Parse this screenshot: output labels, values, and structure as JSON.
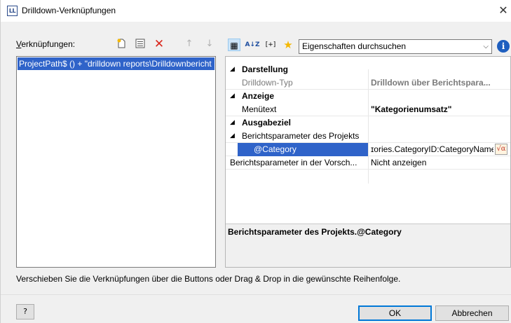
{
  "window": {
    "title": "Drilldown-Verknüpfungen",
    "app_icon_text": "LL",
    "close_glyph": "✕"
  },
  "left": {
    "label_prefix": "V",
    "label_rest": "erknüpfungen:",
    "toolbar": {
      "new_icon": "new-document-icon",
      "properties_icon": "list-properties-icon",
      "delete_icon": "delete-x-icon",
      "delete_glyph": "✕",
      "up_glyph": "↑",
      "down_glyph": "↓",
      "delete_color": "#d9261c"
    },
    "items": [
      {
        "label": "ProjectPath$ () + \"drilldown reports\\Drilldownbericht"
      }
    ]
  },
  "right": {
    "toolbar": {
      "categorized_glyph": "▦",
      "sort_glyph": "A↓Z",
      "expand_glyph": "[+]",
      "favorite_glyph": "★",
      "favorite_color": "#f5b800"
    },
    "search": {
      "placeholder": "Eigenschaften durchsuchen",
      "chevron": "⌵"
    },
    "info_glyph": "i",
    "grid": {
      "cat1": {
        "label": "Darstellung"
      },
      "drilldown_type": {
        "name": "Drilldown-Typ",
        "value": "Drilldown über Berichtspara..."
      },
      "cat2": {
        "label": "Anzeige"
      },
      "menutext": {
        "name": "Menütext",
        "value": "\"Kategorienumsatz\""
      },
      "cat3": {
        "label": "Ausgabeziel"
      },
      "report_params": {
        "name": "Berichtsparameter des Projekts",
        "value": ""
      },
      "category": {
        "name": "@Category",
        "value": "ɪories.CategoryID:CategoryName",
        "formula_glyph": "√α"
      },
      "preview_params": {
        "name": "Berichtsparameter in der Vorsch...",
        "value": "Nicht anzeigen"
      }
    },
    "description": {
      "title": "Berichtsparameter des Projekts.@Category"
    }
  },
  "hint": "Verschieben Sie die Verknüpfungen über die Buttons oder Drag & Drop in die gewünschte Reihenfolge.",
  "buttons": {
    "help_glyph": "?",
    "ok": "OK",
    "cancel": "Abbrechen"
  },
  "colors": {
    "selection": "#2f63c9",
    "accent": "#0078d7"
  }
}
